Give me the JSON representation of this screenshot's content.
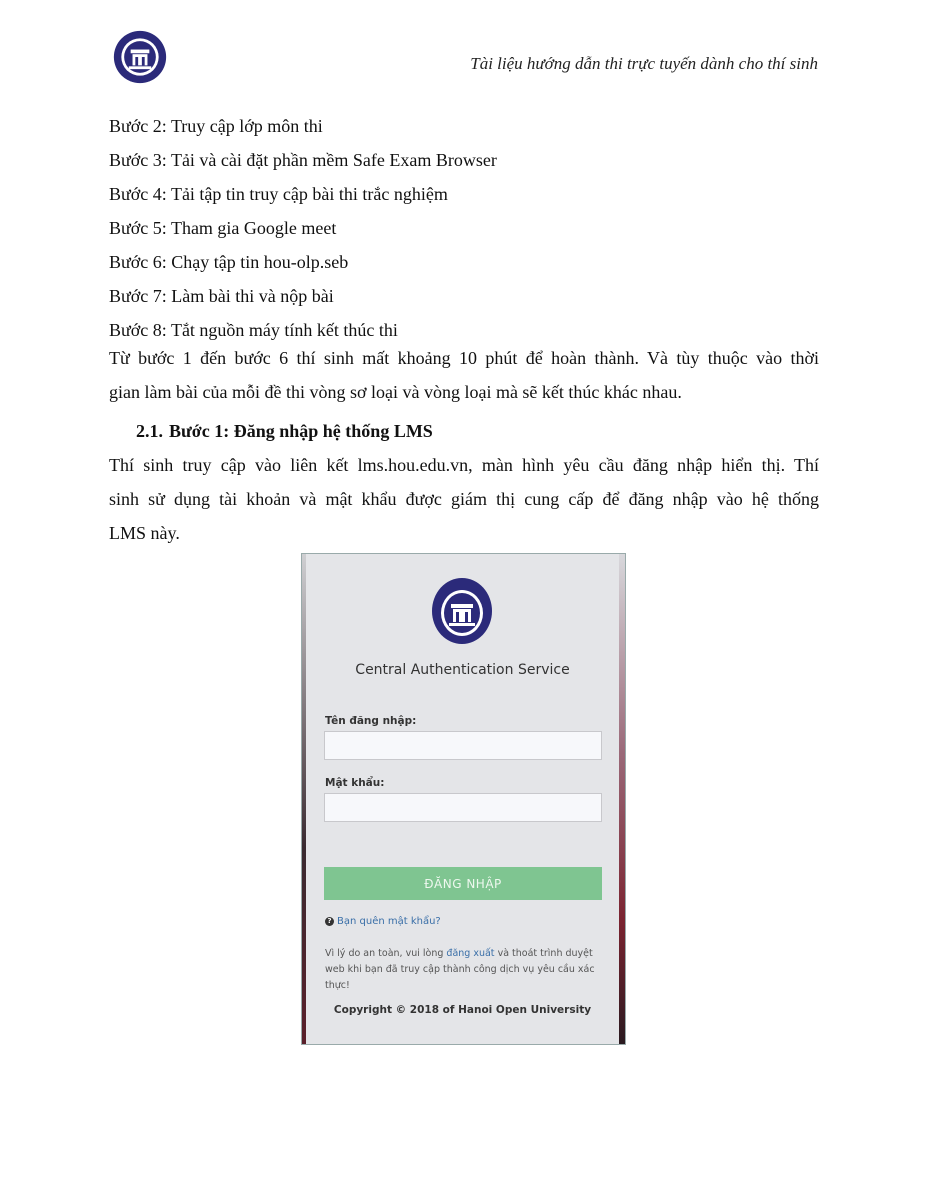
{
  "header": {
    "title": "Tài liệu hướng dẫn thi trực tuyến dành cho thí sinh",
    "logo_icon": "hanoi-open-university-logo"
  },
  "steps": [
    "Bước 2: Truy cập lớp môn thi",
    "Bước 3: Tải và cài đặt phần mềm Safe Exam Browser",
    "Bước 4: Tải tập tin truy cập bài thi trắc nghiệm",
    "Bước 5: Tham gia Google meet",
    "Bước 6: Chạy tập tin hou-olp.seb",
    "Bước 7: Làm bài thi và nộp bài",
    "Bước 8: Tắt nguồn máy tính kết thúc thi"
  ],
  "summary": {
    "line1": "Từ bước 1 đến bước 6 thí sinh mất khoảng 10 phút để hoàn thành. Và tùy thuộc vào thời",
    "line2": "gian làm bài của mỗi đề thi vòng sơ loại và vòng loại mà sẽ kết thúc khác nhau."
  },
  "section": {
    "number": "2.1.",
    "title": "Bước 1: Đăng nhập hệ thống LMS"
  },
  "intro": {
    "line1": "Thí sinh truy cập vào liên kết lms.hou.edu.vn, màn hình yêu cầu đăng nhập hiển thị. Thí",
    "line2": "sinh sử dụng tài khoản và mật khẩu được giám thị cung cấp để đăng nhập vào hệ thống",
    "line3": "LMS này."
  },
  "login_screenshot": {
    "title": "Central Authentication Service",
    "username_label": "Tên đăng nhập:",
    "username_value": "",
    "password_label": "Mật khẩu:",
    "password_value": "",
    "login_button": "ĐĂNG NHẬP",
    "forgot_password": "Bạn quên mật khẩu?",
    "notice_before": "Vì lý do an toàn, vui lòng ",
    "notice_link": "đăng xuất",
    "notice_after": " và thoát trình duyệt web khi bạn đã truy cập thành công dịch vụ yêu cầu xác thực!",
    "copyright": "Copyright © 2018 of Hanoi Open University",
    "colors": {
      "button": "#7fc591",
      "link": "#3a6fa8",
      "logo": "#2b2a7a"
    }
  }
}
